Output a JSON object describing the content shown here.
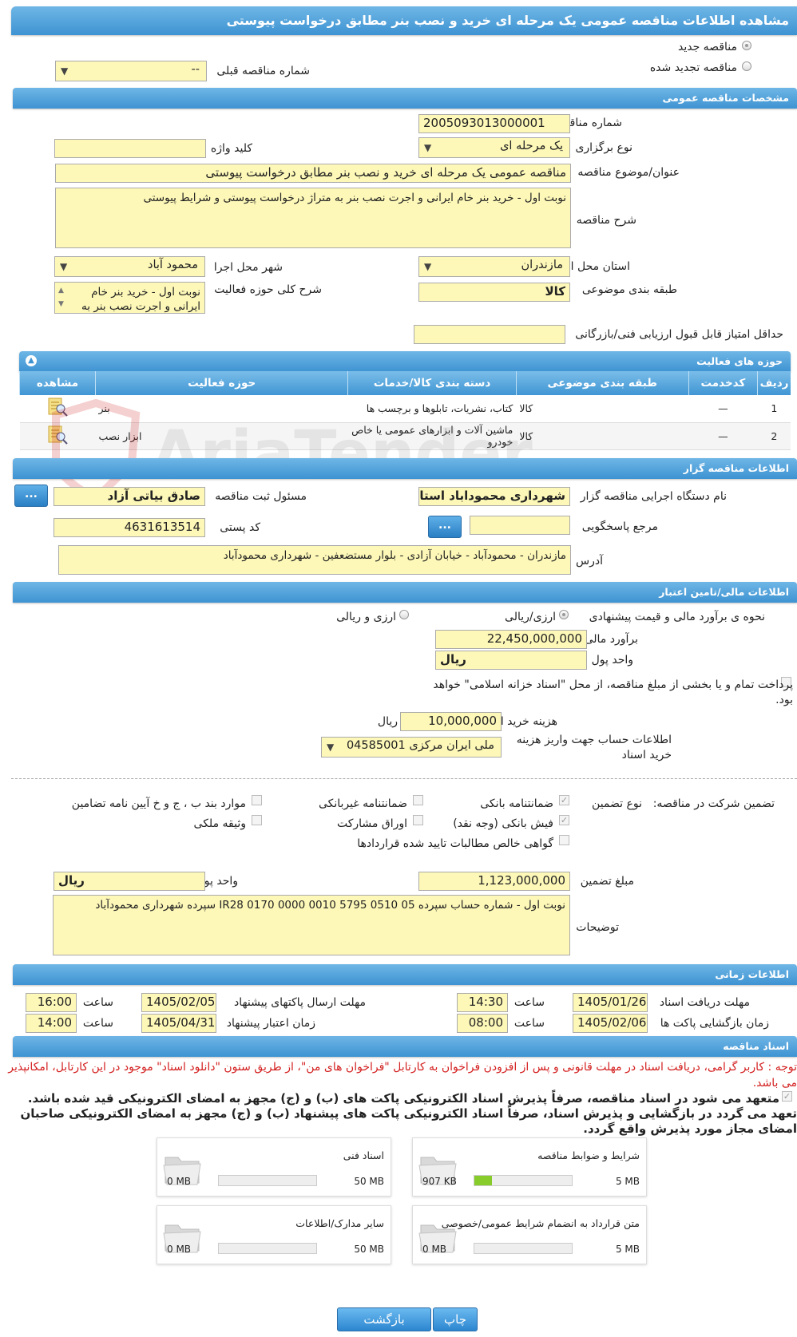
{
  "page_title": "مشاهده اطلاعات مناقصه عمومی یک مرحله ای خرید و نصب بنر مطابق درخواست پیوستی",
  "tender_type": {
    "new_label": "مناقصه جدید",
    "renewed_label": "مناقصه تجدید شده",
    "previous_number_label": "شماره مناقصه قبلی",
    "previous_number_value": "--"
  },
  "general": {
    "section_title": "مشخصات مناقصه عمومی",
    "number_label": "شماره مناقصه",
    "number_value": "2005093013000001",
    "holding_type_label": "نوع برگزاری",
    "holding_type_value": "یک مرحله ای",
    "keyword_label": "کلید واژه",
    "keyword_value": "",
    "subject_label": "عنوان/موضوع مناقصه",
    "subject_value": "مناقصه عمومی یک مرحله ای خرید و نصب بنر مطابق درخواست پیوستی",
    "description_label": "شرح مناقصه",
    "description_value": "نوبت اول - خرید بنر خام ایرانی و اجرت نصب بنر به متراژ درخواست پیوستی و شرایط پیوستی",
    "province_label": "استان محل اجرا",
    "province_value": "مازندران",
    "city_label": "شهر محل اجرا",
    "city_value": "محمود آباد",
    "category_label": "طبقه بندی موضوعی",
    "category_value": "کالا",
    "activity_desc_label": "شرح کلی حوزه فعالیت",
    "activity_desc_value": "نوبت اول - خرید بنر خام ایرانی و اجرت نصب بنر به",
    "min_score_label": "حداقل امتیاز قابل قبول ارزیابی فنی/بازرگانی",
    "min_score_value": ""
  },
  "activities": {
    "title": "حوزه های فعالیت",
    "headers": [
      "ردیف",
      "کدخدمت",
      "طبقه بندی موضوعی",
      "دسته بندی کالا/خدمات",
      "حوزه فعالیت",
      "مشاهده"
    ],
    "rows": [
      {
        "index": "1",
        "code": "—",
        "category": "کالا",
        "group": "کتاب، نشریات، تابلوها و برچسب ها",
        "field": "بنر"
      },
      {
        "index": "2",
        "code": "—",
        "category": "کالا",
        "group": "ماشین آلات و ابزارهای عمومی یا خاص خودرو",
        "field": "ابزار نصب"
      }
    ],
    "watermark": "AriaTender.neT"
  },
  "organizer": {
    "section_title": "اطلاعات مناقصه گزار",
    "org_label": "نام دستگاه اجرایی مناقصه گزار",
    "org_value": "شهرداری محموداباد استان",
    "registrar_label": "مسئول ثبت مناقصه",
    "registrar_value": "صادق بیاتی آزاد",
    "responder_label": "مرجع پاسخگویی",
    "responder_value": "",
    "postal_label": "کد پستی",
    "postal_value": "4631613514",
    "address_label": "آدرس",
    "address_value": "مازندران - محمودآباد - خیابان آزادی - بلوار مستضعفین - شهرداری محمودآباد",
    "dots": "..."
  },
  "finance": {
    "section_title": "اطلاعات مالی/تامین اعتبار",
    "method_label": "نحوه ی برآورد مالی و قیمت پیشنهادی",
    "method_opt1": "ارزی/ریالی",
    "method_opt2": "ارزی و ریالی",
    "estimate_label": "برآورد مالی",
    "estimate_value": "22,450,000,000",
    "currency_label": "واحد پول",
    "currency_value": "ریال",
    "treasury_text": "پرداخت تمام و یا بخشی از مبلغ مناقصه، از محل \"اسناد خزانه اسلامی\" خواهد بود.",
    "doc_fee_label": "هزینه خرید اسناد",
    "doc_fee_value": "10,000,000",
    "doc_fee_unit": "ریال",
    "account_label": "اطلاعات حساب جهت واریز هزینه خرید اسناد",
    "account_value": "ملی ایران مرکزی 04585001"
  },
  "guarantee": {
    "label": "تضمین شرکت در مناقصه:",
    "type_label": "نوع تضمین",
    "options": [
      {
        "label": "ضمانتنامه بانکی",
        "checked": true
      },
      {
        "label": "ضمانتنامه غیربانکی",
        "checked": false
      },
      {
        "label": "موارد بند ب ، ج و خ آیین نامه تضامین",
        "checked": false
      },
      {
        "label": "فیش بانکی (وجه نقد)",
        "checked": true
      },
      {
        "label": "اوراق مشارکت",
        "checked": false
      },
      {
        "label": "وثیقه ملکی",
        "checked": false
      },
      {
        "label": "گواهی خالص مطالبات تایید شده قراردادها",
        "checked": false
      }
    ],
    "amount_label": "مبلغ تضمین",
    "amount_value": "1,123,000,000",
    "currency_label": "واحد پول",
    "currency_value": "ریال",
    "notes_label": "توضیحات",
    "notes_value": "نوبت اول - شماره حساب سپرده  IR28 0170 0000 0010 5795 0510 05 سپرده شهرداری محمودآباد"
  },
  "timing": {
    "section_title": "اطلاعات زمانی",
    "receive_label": "مهلت دریافت اسناد",
    "receive_date": "1405/01/26",
    "receive_time": "14:30",
    "send_label": "مهلت ارسال پاکتهای پیشنهاد",
    "send_date": "1405/02/05",
    "send_time": "16:00",
    "open_label": "زمان بازگشایی پاکت ها",
    "open_date": "1405/02/06",
    "open_time": "08:00",
    "validity_label": "زمان اعتبار پیشنهاد",
    "validity_date": "1405/04/31",
    "validity_time": "14:00",
    "time_label": "ساعت"
  },
  "documents": {
    "section_title": "اسناد مناقصه",
    "notice": "توجه : کاربر گرامی، دریافت اسناد در مهلت قانونی و پس از افزودن فراخوان به کارتابل \"فراخوان های من\"، از طریق ستون \"دانلود اسناد\" موجود در این کارتابل، امکانپذیر می باشد.",
    "pledge": "متعهد می شود در اسناد مناقصه، صرفاً پذیرش اسناد الکترونیکی پاکت های (ب) و (ج) مجهز به امضای الکترونیکی قید شده باشد. تعهد می گردد در بازگشایی و پذیرش اسناد، صرفاً اسناد الکترونیکی پاکت های پیشنهاد (ب) و (ج) مجهز به امضای الکترونیکی صاحبان امضای مجاز مورد پذیرش واقع گردد.",
    "items": [
      {
        "title": "شرایط و ضوابط مناقصه",
        "min": "907 KB",
        "max": "5 MB",
        "fill": 0.18
      },
      {
        "title": "اسناد فنی",
        "min": "0 MB",
        "max": "50 MB",
        "fill": 0
      },
      {
        "title": "متن قرارداد به انضمام شرایط عمومی/خصوصی",
        "min": "0 MB",
        "max": "5 MB",
        "fill": 0
      },
      {
        "title": "سایر مدارک/اطلاعات",
        "min": "0 MB",
        "max": "50 MB",
        "fill": 0
      }
    ]
  },
  "footer": {
    "print_label": "چاپ",
    "back_label": "بازگشت"
  },
  "colors": {
    "field_bg": "#fdf8b8",
    "bar_top": "#6fb6e6",
    "bar_bottom": "#3d93d2",
    "notice_red": "#d42020",
    "progress_green": "#88cc2c"
  }
}
